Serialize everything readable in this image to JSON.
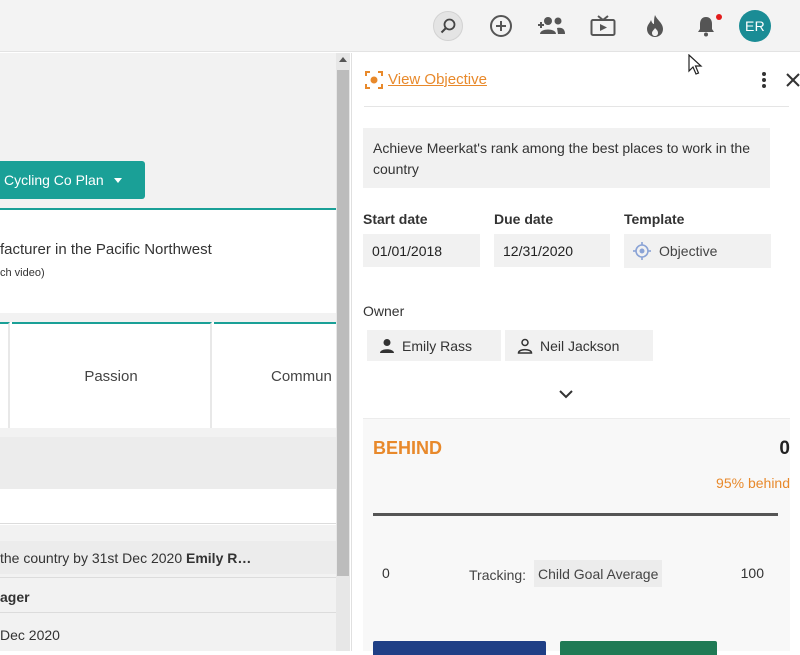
{
  "topbar": {
    "icons": [
      "search-icon",
      "add-circle-icon",
      "people-icon",
      "tv-icon",
      "fire-icon",
      "bell-icon"
    ],
    "avatar_initials": "ER",
    "notification_dot_color": "#e21b1b"
  },
  "background": {
    "plan_button_label": "Cycling Co Plan",
    "mission_text": "facturer in the Pacific Northwest",
    "mission_sub": "ch video)",
    "values": [
      "Passion",
      "Commun"
    ],
    "objective_row_text": "the country by 31st Dec 2020 ",
    "objective_row_owner": "Emily R…",
    "row_label_a": "ager",
    "row_label_b": "Dec 2020",
    "accent_color": "#1aa097"
  },
  "panel": {
    "title": "View Objective",
    "description": "Achieve Meerkat's rank among the best places to work in the country",
    "start_date_label": "Start date",
    "start_date": "01/01/2018",
    "due_date_label": "Due date",
    "due_date": "12/31/2020",
    "template_label": "Template",
    "template_value": "Objective",
    "owner_label": "Owner",
    "owners": [
      "Emily Rass",
      "Neil Jackson"
    ],
    "status_label": "BEHIND",
    "status_value": "0",
    "status_detail": "95% behind",
    "progress_min": "0",
    "progress_max": "100",
    "tracking_label": "Tracking:",
    "tracking_value": "Child Goal Average",
    "accent_color": "#e8892b"
  }
}
